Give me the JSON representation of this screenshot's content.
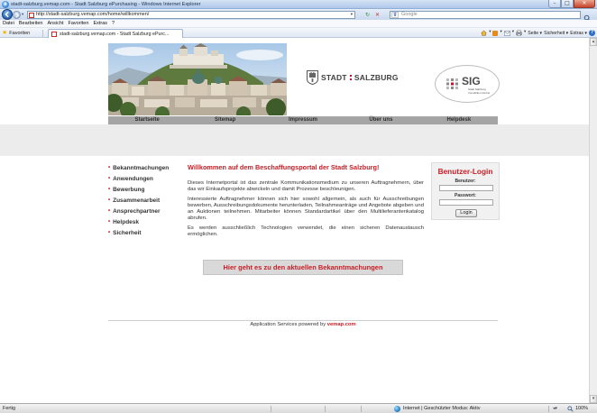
{
  "window": {
    "title": "stadt-salzburg.vemap.com - Stadt Salzburg ePurchasing - Windows Internet Explorer"
  },
  "browser": {
    "address": "http://stadt-salzburg.vemap.com/home/willkommen/",
    "search_placeholder": "Google",
    "menu": [
      "Datei",
      "Bearbeiten",
      "Ansicht",
      "Favoriten",
      "Extras",
      "?"
    ],
    "favorites_label": "Favoriten",
    "tab_title": "stadt-salzburg.vemap.com - Stadt Salzburg ePurc...",
    "command": {
      "page": "Seite ▾",
      "safety": "Sicherheit ▾",
      "tools": "Extras ▾"
    },
    "status": {
      "left": "Fertig",
      "zone": "Internet | Geschützter Modus: Aktiv",
      "zoom": "100%"
    }
  },
  "page": {
    "logos": {
      "city_left": "STADT",
      "city_right": "SALZBURG",
      "sig": "SIG",
      "sig_sub_1": "Stadt Salzburg",
      "sig_sub_2": "Immobilien GmbH"
    },
    "nav": [
      "Startseite",
      "Sitemap",
      "Impressum",
      "Über uns",
      "Helpdesk"
    ],
    "sidebar": [
      "Bekanntmachungen",
      "Anwendungen",
      "Bewerbung",
      "Zusammenarbeit",
      "Ansprechpartner",
      "Helpdesk",
      "Sicherheit"
    ],
    "welcome": {
      "heading": "Willkommen auf dem Beschaffungsportal der Stadt Salzburg!",
      "paragraphs": [
        "Dieses Internetportal ist das zentrale Kommunikationsmedium zu unseren Auftragnehmern, über das wir Einkaufsprojekte abwickeln und damit Prozesse beschleunigen.",
        "Interessierte Auftragnehmer können sich hier sowohl allgemein, als auch für Ausschreibungen bewerben, Ausschreibungsdokumente herunterladen, Teilnahmeanträge und Angebote abgeben und an Auktionen teilnehmen. Mitarbeiter können Standardartikel über den Multilieferantenkatalog abrufen.",
        "Es werden ausschließlich Technologien verwendet, die einen sicheren Datenaustausch ermöglichen."
      ]
    },
    "cta_button": "Hier geht es zu den aktuellen Bekanntmachungen",
    "login": {
      "title": "Benutzer-Login",
      "user_label": "Benutzer:",
      "password_label": "Passwort:",
      "button": "Login"
    },
    "footer": {
      "text": "Application Services powered by ",
      "link": "vemap.com"
    }
  },
  "colors": {
    "accent_red": "#c81d25",
    "nav_gray": "#a5a5a5",
    "strip_gray": "#ececec"
  }
}
